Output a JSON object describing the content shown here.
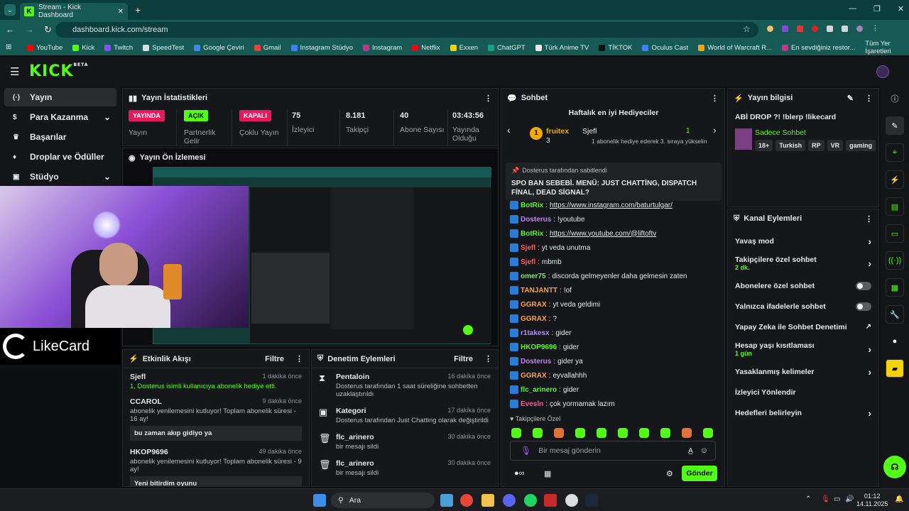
{
  "browser": {
    "tab_title": "Stream - Kick Dashboard",
    "url": "dashboard.kick.com/stream",
    "bookmarks": [
      "YouTube",
      "Kick",
      "Twitch",
      "SpeedTest",
      "Google Çeviri",
      "Gmail",
      "Instagram Stüdyo",
      "Instagram",
      "Netflix",
      "Exxen",
      "ChatGPT",
      "Türk Anime TV",
      "TİKTOK",
      "Oculus Cast",
      "World of Warcraft R...",
      "En sevdiğiniz restor..."
    ],
    "bookmarks_all": "Tüm Yer İşaretleri"
  },
  "header": {
    "logo": "KICK",
    "beta": "BETA"
  },
  "sidenav": [
    {
      "label": "Yayın",
      "icon": "(·)"
    },
    {
      "label": "Para Kazanma",
      "icon": "$"
    },
    {
      "label": "Başarılar",
      "icon": "♛"
    },
    {
      "label": "Droplar ve Ödüller",
      "icon": "♦"
    },
    {
      "label": "Stüdyo",
      "icon": "▣"
    }
  ],
  "stats": {
    "title": "Yayın İstatistikleri",
    "items": [
      {
        "value": "YAYINDA",
        "label": "Yayın",
        "badge": "#e5195c"
      },
      {
        "value": "AÇIK",
        "label": "Partnerlik Gelir",
        "badge": "#53fc18"
      },
      {
        "value": "KAPALI",
        "label": "Çoklu Yayın",
        "badge": "#e5195c"
      },
      {
        "value": "75",
        "label": "İzleyici"
      },
      {
        "value": "8.181",
        "label": "Takipçi"
      },
      {
        "value": "40",
        "label": "Abone Sayısı"
      },
      {
        "value": "03:43:56",
        "label": "Yayında Olduğu"
      }
    ]
  },
  "preview": {
    "title": "Yayın Ön İzlemesi",
    "overlay": "LikeCard"
  },
  "activity": {
    "title": "Etkinlik Akışı",
    "filter": "Filtre",
    "events": [
      {
        "user": "Sjefl",
        "time": "1 dakika önce",
        "text": "1, Dosterus isimli kullanıcıya abonelik hediye etti."
      },
      {
        "user": "CCAROL",
        "time": "9 dakika önce",
        "text": "abonelik yenilemesini kutluyor! Toplam abonelik süresi - 16 ay!",
        "msg": "bu zaman akıp gidiyo ya"
      },
      {
        "user": "HKOP9696",
        "time": "49 dakika önce",
        "text": "abonelik yenilemesini kutluyor! Toplam abonelik süresi - 9 ay!",
        "msg": "Yeni bitirdim oyunu"
      }
    ]
  },
  "moderation": {
    "title": "Denetim Eylemleri",
    "filter": "Filtre",
    "events": [
      {
        "title": "Pentaloin",
        "time": "16 dakika önce",
        "text": "Dosterus tarafından 1 saat süreliğine sohbetten uzaklaştırıldı"
      },
      {
        "title": "Kategori",
        "time": "17 dakika önce",
        "text": "Dosterus tarafından Just Chatting olarak değiştirildi"
      },
      {
        "title": "flc_arinero",
        "time": "30 dakika önce",
        "text": "bir mesajı sildi"
      },
      {
        "title": "flc_arinero",
        "time": "30 dakika önce",
        "text": "bir mesajı sildi"
      }
    ]
  },
  "chat": {
    "title": "Sohbet",
    "gifters_title": "Haftalık en iyi Hediyeciler",
    "top_gifter": "fruitex",
    "top_gifter_count": "1",
    "top_gifter_num": "3",
    "second": "Sjefl",
    "second_text": "1 abonelik hediye ederek 3. sıraya yükselin",
    "pinned_by": "Dosterus tarafından sabitlendi",
    "pinned_text": "SPO BAN SEBEBİ. MENÜ: JUST CHATTİNG, DISPATCH FİNAL, DEAD SİGNAL?",
    "messages": [
      {
        "user": "BotRix",
        "color": "#53fc18",
        "text": "https://www.instagram.com/baturtulgar/"
      },
      {
        "user": "Dosterus",
        "color": "#c77dff",
        "text": "!youtube"
      },
      {
        "user": "BotRix",
        "color": "#53fc18",
        "text": "https://www.youtube.com/@liftoftv"
      },
      {
        "user": "Sjefl",
        "color": "#ff5a5a",
        "text": "yt veda unutma"
      },
      {
        "user": "Sjefl",
        "color": "#ff5a5a",
        "text": "mbmb"
      },
      {
        "user": "omer75",
        "color": "#7be37b",
        "text": "discorda gelmeyenler daha gelmesin zaten"
      },
      {
        "user": "TANJANTT",
        "color": "#ff9f40",
        "text": "!of"
      },
      {
        "user": "GGRAX",
        "color": "#ff9f40",
        "text": "yt veda geldimi"
      },
      {
        "user": "GGRAX",
        "color": "#ff9f40",
        "text": "?"
      },
      {
        "user": "r1takesx",
        "color": "#b388ff",
        "text": "gider"
      },
      {
        "user": "HKOP9696",
        "color": "#53fc18",
        "text": "gider"
      },
      {
        "user": "Dosterus",
        "color": "#c77dff",
        "text": "gider ya"
      },
      {
        "user": "GGRAX",
        "color": "#ff9f40",
        "text": "eyvallahhh"
      },
      {
        "user": "flc_arinero",
        "color": "#53fc18",
        "text": "gider"
      },
      {
        "user": "Evesln",
        "color": "#ff5a8a",
        "text": "çok yormamak lazım"
      }
    ],
    "followers_only": "Takipçilere Özel",
    "placeholder": "Bir mesaj gönderin",
    "send": "Gönder"
  },
  "info": {
    "title": "Yayın bilgisi",
    "stream_title": "ABİ DROP ?! !blerp !likecard",
    "category": "Sadece Sohbet",
    "tags": [
      "18+",
      "Turkish",
      "RP",
      "VR",
      "gaming"
    ]
  },
  "channel": {
    "title": "Kanal Eylemleri",
    "rows": [
      {
        "label": "Yavaş mod",
        "type": "arrow"
      },
      {
        "label": "Takipçilere özel sohbet",
        "sub": "2 dk.",
        "type": "arrow"
      },
      {
        "label": "Abonelere özel sohbet",
        "type": "toggle"
      },
      {
        "label": "Yalnızca ifadelerle sohbet",
        "type": "toggle"
      },
      {
        "label": "Yapay Zeka ile Sohbet Denetimi",
        "type": "ext"
      },
      {
        "label": "Hesap yaşı kısıtlaması",
        "sub": "1 gün",
        "type": "arrow"
      },
      {
        "label": "Yasaklanmış kelimeler",
        "type": "arrow"
      },
      {
        "label": "İzleyici Yönlendir",
        "type": "none"
      },
      {
        "label": "Hedefleri belirleyin",
        "type": "arrow"
      }
    ]
  },
  "taskbar": {
    "search": "Ara",
    "time": "01:12",
    "date": "14.11.2025"
  }
}
